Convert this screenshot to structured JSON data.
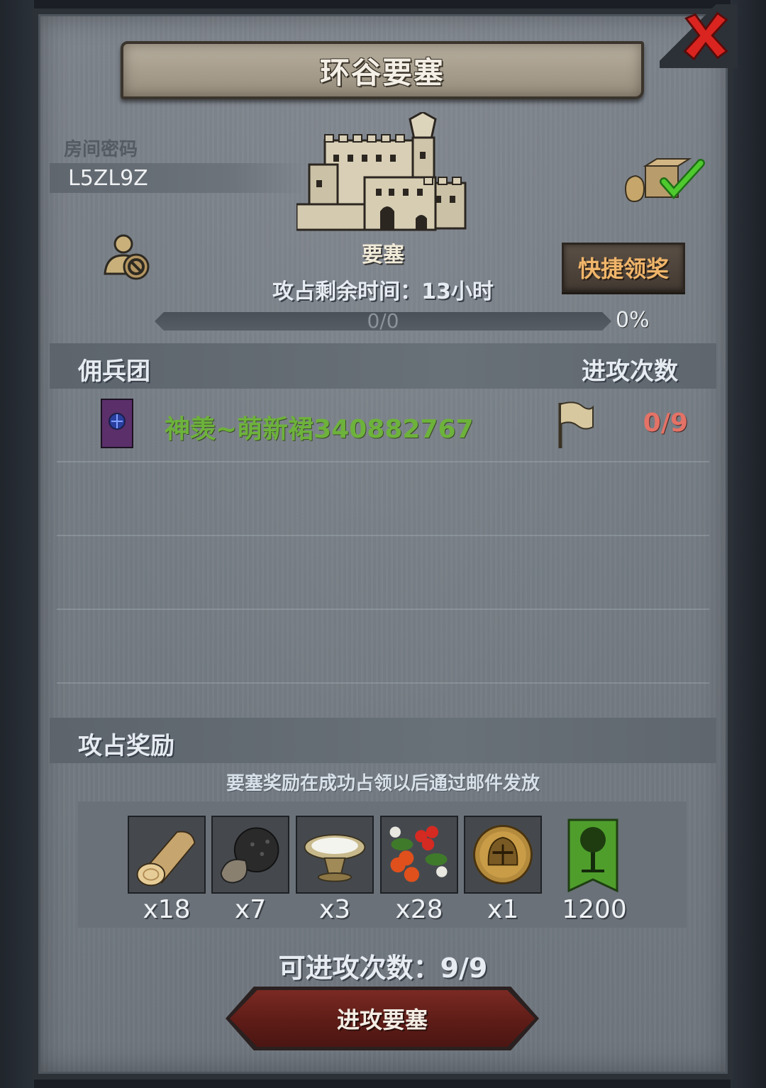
{
  "title": "环谷要塞",
  "room": {
    "label": "房间密码",
    "code": "L5ZL9Z"
  },
  "fortress": {
    "label": "要塞"
  },
  "quick_claim": {
    "label": "快捷领奖"
  },
  "remaining_time": "攻占剩余时间：13小时",
  "progress": {
    "text": "0/0",
    "percent_text": "0%",
    "fraction": 0
  },
  "mercenary_section": {
    "title": "佣兵团",
    "count_header": "进攻次数",
    "rows": [
      {
        "name": "神羡~萌新裙340882767",
        "attack_count": "0/9"
      }
    ]
  },
  "reward_section": {
    "title": "攻占奖励",
    "note": "要塞奖励在成功占领以后通过邮件发放",
    "items": [
      {
        "icon": "wood-log-icon",
        "qty": "x18"
      },
      {
        "icon": "truffle-icon",
        "qty": "x7"
      },
      {
        "icon": "milk-bowl-icon",
        "qty": "x3"
      },
      {
        "icon": "berries-icon",
        "qty": "x28"
      },
      {
        "icon": "knight-helmet-coin-icon",
        "qty": "x1"
      },
      {
        "icon": "green-tree-banner-icon",
        "qty": "1200"
      }
    ]
  },
  "attacks_left": "可进攻次数：9/9",
  "attack_button": {
    "label": "进攻要塞"
  },
  "colors": {
    "merc_name": "#6db23b",
    "attack_count": "#e47266",
    "quick_claim_text": "#f0b56a",
    "close_x": "#d92420"
  }
}
